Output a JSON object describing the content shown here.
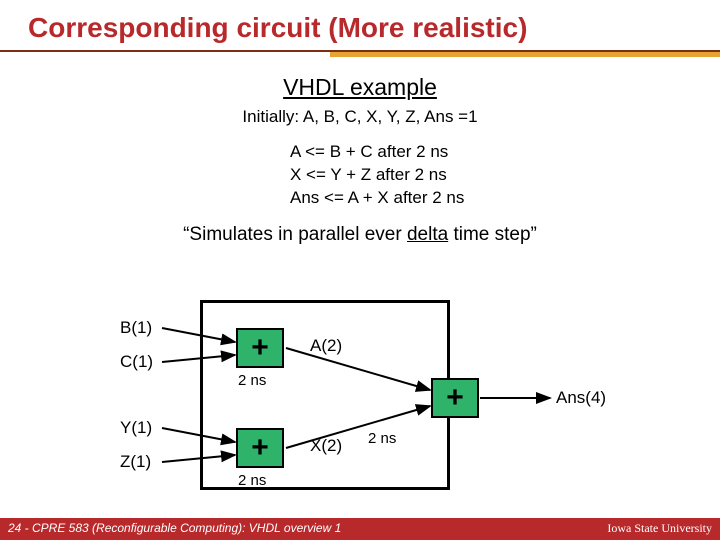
{
  "title": "Corresponding circuit (More realistic)",
  "subtitle": "VHDL example",
  "initially": "Initially: A, B, C, X, Y, Z, Ans =1",
  "code": {
    "l1": "A <= B + C after 2 ns",
    "l2": "X <= Y + Z  after 2 ns",
    "l3": "Ans <= A + X after 2 ns"
  },
  "simulate_prefix": "“Simulates in parallel ever ",
  "simulate_delta": "delta",
  "simulate_suffix": " time step”",
  "signals": {
    "b": "B(1)",
    "c": "C(1)",
    "y": "Y(1)",
    "z": "Z(1)",
    "a": "A(2)",
    "x": "X(2)",
    "ans": "Ans(4)"
  },
  "adder_symbol": "+",
  "delay": "2 ns",
  "footer": {
    "left": "24 - CPRE 583 (Reconfigurable Computing):  VHDL overview 1",
    "right": "Iowa State University"
  }
}
